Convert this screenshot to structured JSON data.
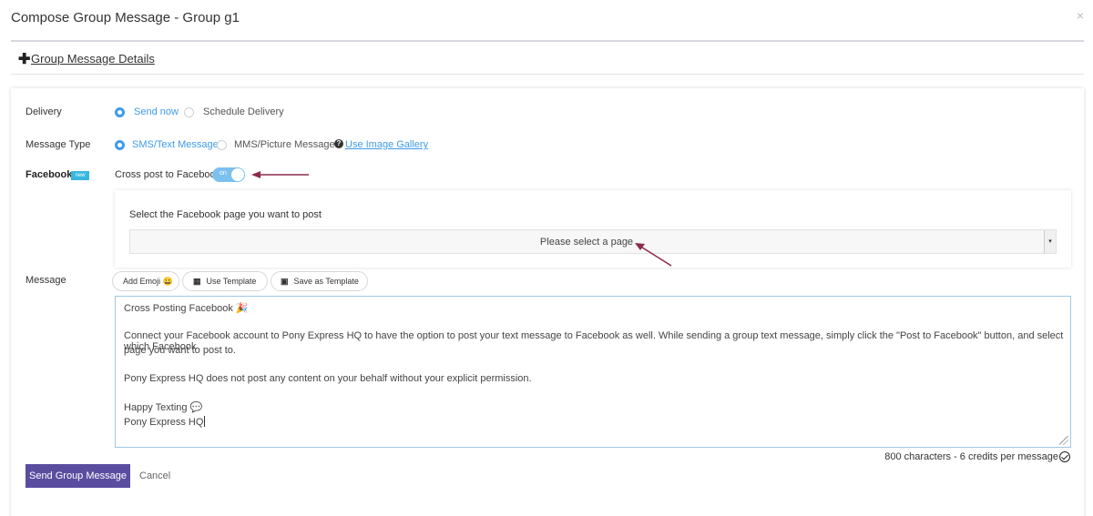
{
  "dialog": {
    "title": "Compose Group Message - Group g1",
    "close_glyph": "×"
  },
  "details": {
    "label": "Group Message Details",
    "icon": "plus-icon"
  },
  "delivery": {
    "label": "Delivery",
    "options": [
      {
        "label": "Send now",
        "selected": true
      },
      {
        "label": "Schedule Delivery",
        "selected": false
      }
    ]
  },
  "message_type": {
    "label": "Message Type",
    "options": [
      {
        "label": "SMS/Text Message",
        "selected": true
      },
      {
        "label": "MMS/Picture Message",
        "selected": false
      }
    ],
    "gallery_link": "Use Image Gallery",
    "help_glyph": "?"
  },
  "facebook": {
    "label": "Facebook",
    "badge": "new",
    "cross_post_label": "Cross post to Facebook",
    "toggle_text": "on",
    "toggle_on": true,
    "select_prompt": "Select the Facebook page you want to post",
    "select_value": "Please select a page",
    "select_arrow": "▾"
  },
  "message": {
    "label": "Message",
    "buttons": {
      "emoji": "Add Emoji 😀",
      "template": "Use Template",
      "save_template": "Save as Template"
    },
    "lines": [
      "Cross Posting Facebook 🎉",
      "Connect your Facebook account to Pony Express HQ to have the option to post your text message to Facebook as well. While sending a group text message, simply click the \"Post to Facebook\" button, and select which Facebook",
      "page you want to post to.",
      "Pony Express HQ does not post any content on your behalf without your explicit permission.",
      "Happy Texting 💬",
      "Pony Express HQ"
    ],
    "counter": "800 characters - 6 credits per message"
  },
  "actions": {
    "send": "Send Group Message",
    "cancel": "Cancel"
  },
  "colors": {
    "accent": "#3d9be9",
    "primary_button": "#5a4da0",
    "annotation_arrow": "#8b2a4a",
    "badge": "#38b6e0"
  }
}
